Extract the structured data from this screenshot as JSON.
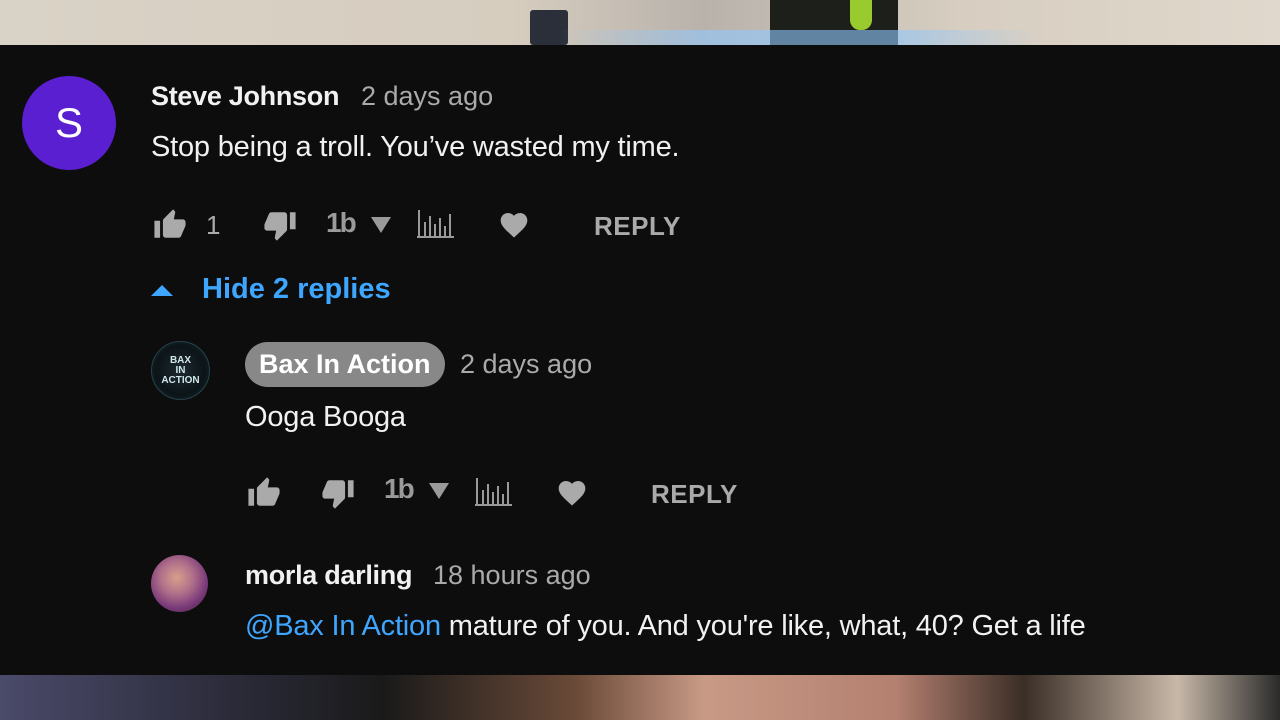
{
  "comment": {
    "avatar_letter": "S",
    "author": "Steve Johnson",
    "time": "2 days ago",
    "text": "Stop being a troll. You’ve wasted my time.",
    "like_count": "1",
    "extension_label": "1b",
    "reply_label": "REPLY"
  },
  "replies_toggle": {
    "label": "Hide 2 replies"
  },
  "replies": [
    {
      "author": "Bax In Action",
      "time": "2 days ago",
      "text": "Ooga Booga",
      "extension_label": "1b",
      "reply_label": "REPLY",
      "avatar_text": "BAX IN ACTION"
    },
    {
      "author": "morla darling",
      "time": "18 hours ago",
      "mention": "@Bax In Action",
      "text": " mature of you. And you're like, what, 40? Get a life"
    }
  ],
  "colors": {
    "panel_bg": "#0d0d0d",
    "accent_blue": "#3ea6ff",
    "avatar_purple": "#5a1fd0",
    "icon_gray": "#aaaaaa"
  }
}
